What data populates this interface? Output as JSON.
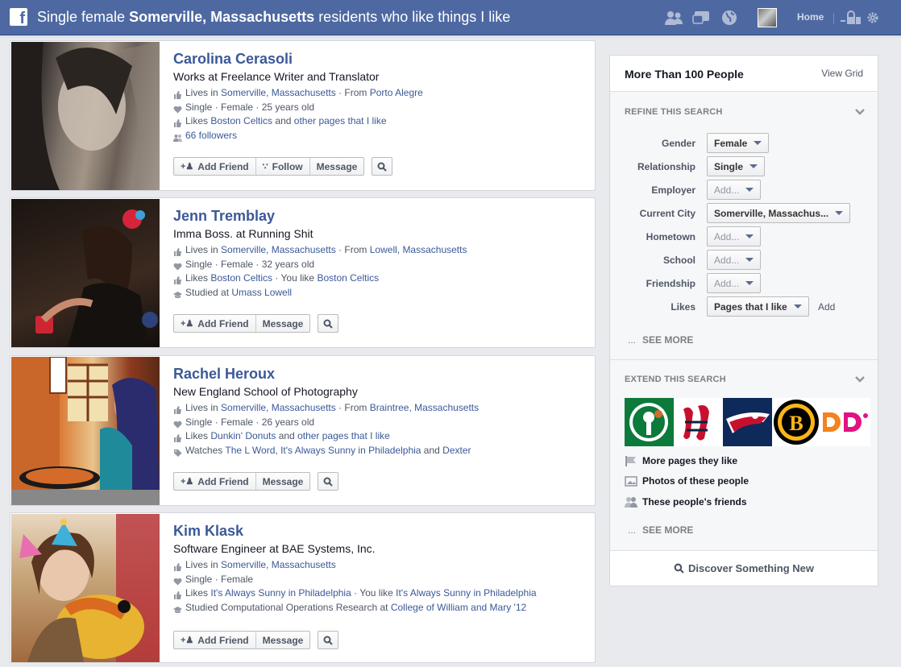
{
  "header": {
    "title_prefix": "Single female ",
    "title_bold": "Somerville, Massachusetts",
    "title_suffix": " residents who like things I like",
    "home_label": "Home",
    "logo_letter": "f"
  },
  "results": [
    {
      "name": "Carolina Cerasoli",
      "headline": "Works at Freelance Writer and Translator",
      "lines": [
        {
          "icon": "thumbs-up-icon",
          "parts": [
            {
              "t": "Lives in "
            },
            {
              "t": "Somerville, Massachusetts",
              "link": true
            },
            {
              "t": " · From "
            },
            {
              "t": "Porto Alegre",
              "link": true
            }
          ]
        },
        {
          "icon": "heart-icon",
          "parts": [
            {
              "t": "Single · Female · 25 years old"
            }
          ]
        },
        {
          "icon": "like-icon",
          "parts": [
            {
              "t": "Likes "
            },
            {
              "t": "Boston Celtics",
              "link": true
            },
            {
              "t": " and "
            },
            {
              "t": "other pages that I like",
              "link": true
            }
          ]
        },
        {
          "icon": "people-icon",
          "parts": [
            {
              "t": "66 followers",
              "link": true
            }
          ]
        }
      ],
      "buttons": [
        "Add Friend",
        "Follow",
        "Message"
      ]
    },
    {
      "name": "Jenn Tremblay",
      "headline": "Imma Boss. at Running Shit",
      "lines": [
        {
          "icon": "thumbs-up-icon",
          "parts": [
            {
              "t": "Lives in "
            },
            {
              "t": "Somerville, Massachusetts",
              "link": true
            },
            {
              "t": " · From "
            },
            {
              "t": "Lowell, Massachusetts",
              "link": true
            }
          ]
        },
        {
          "icon": "heart-icon",
          "parts": [
            {
              "t": "Single · Female · 32 years old"
            }
          ]
        },
        {
          "icon": "like-icon",
          "parts": [
            {
              "t": "Likes "
            },
            {
              "t": "Boston Celtics",
              "link": true
            },
            {
              "t": " · You like "
            },
            {
              "t": "Boston Celtics",
              "link": true
            }
          ]
        },
        {
          "icon": "school-icon",
          "parts": [
            {
              "t": "Studied at "
            },
            {
              "t": "Umass Lowell",
              "link": true
            }
          ]
        }
      ],
      "buttons": [
        "Add Friend",
        "Message"
      ]
    },
    {
      "name": "Rachel Heroux",
      "headline": "New England School of Photography",
      "lines": [
        {
          "icon": "thumbs-up-icon",
          "parts": [
            {
              "t": "Lives in "
            },
            {
              "t": "Somerville, Massachusetts",
              "link": true
            },
            {
              "t": " · From "
            },
            {
              "t": "Braintree, Massachusetts",
              "link": true
            }
          ]
        },
        {
          "icon": "heart-icon",
          "parts": [
            {
              "t": "Single · Female · 26 years old"
            }
          ]
        },
        {
          "icon": "like-icon",
          "parts": [
            {
              "t": "Likes "
            },
            {
              "t": "Dunkin' Donuts",
              "link": true
            },
            {
              "t": " and "
            },
            {
              "t": "other pages that I like",
              "link": true
            }
          ]
        },
        {
          "icon": "tag-icon",
          "parts": [
            {
              "t": "Watches "
            },
            {
              "t": "The L Word",
              "link": true
            },
            {
              "t": ", "
            },
            {
              "t": "It's Always Sunny in Philadelphia",
              "link": true
            },
            {
              "t": " and "
            },
            {
              "t": "Dexter",
              "link": true
            }
          ]
        }
      ],
      "buttons": [
        "Add Friend",
        "Message"
      ]
    },
    {
      "name": "Kim Klask",
      "headline": "Software Engineer at BAE Systems, Inc.",
      "lines": [
        {
          "icon": "thumbs-up-icon",
          "parts": [
            {
              "t": "Lives in "
            },
            {
              "t": "Somerville, Massachusetts",
              "link": true
            }
          ]
        },
        {
          "icon": "heart-icon",
          "parts": [
            {
              "t": "Single · Female"
            }
          ]
        },
        {
          "icon": "like-icon",
          "parts": [
            {
              "t": "Likes "
            },
            {
              "t": "It's Always Sunny in Philadelphia",
              "link": true
            },
            {
              "t": " · You like "
            },
            {
              "t": "It's Always Sunny in Philadelphia",
              "link": true
            }
          ]
        },
        {
          "icon": "school-icon",
          "parts": [
            {
              "t": "Studied Computational Operations Research at "
            },
            {
              "t": "College of William and Mary '12",
              "link": true
            }
          ]
        }
      ],
      "buttons": [
        "Add Friend",
        "Message"
      ]
    }
  ],
  "panel": {
    "title": "More Than 100 People",
    "view_grid": "View Grid",
    "refine_label": "REFINE THIS SEARCH",
    "filters": [
      {
        "label": "Gender",
        "value": "Female",
        "placeholder": false
      },
      {
        "label": "Relationship",
        "value": "Single",
        "placeholder": false
      },
      {
        "label": "Employer",
        "value": "Add...",
        "placeholder": true
      },
      {
        "label": "Current City",
        "value": "Somerville, Massachus...",
        "placeholder": false
      },
      {
        "label": "Hometown",
        "value": "Add...",
        "placeholder": true
      },
      {
        "label": "School",
        "value": "Add...",
        "placeholder": true
      },
      {
        "label": "Friendship",
        "value": "Add...",
        "placeholder": true
      },
      {
        "label": "Likes",
        "value": "Pages that I like",
        "placeholder": false
      }
    ],
    "likes_add": "Add",
    "see_more": "SEE MORE",
    "see_more_dots": "...",
    "extend_label": "EXTEND THIS SEARCH",
    "extend_logos": [
      "boston-celtics-logo",
      "boston-red-sox-logo",
      "new-england-patriots-logo",
      "boston-bruins-logo",
      "dunkin-donuts-logo"
    ],
    "extend_items": [
      {
        "icon": "flag-icon",
        "label": "More pages they like"
      },
      {
        "icon": "photos-icon",
        "label": "Photos of these people"
      },
      {
        "icon": "friends-icon",
        "label": "These people's friends"
      }
    ],
    "see_more_2": "SEE MORE",
    "discover": "Discover Something New"
  }
}
